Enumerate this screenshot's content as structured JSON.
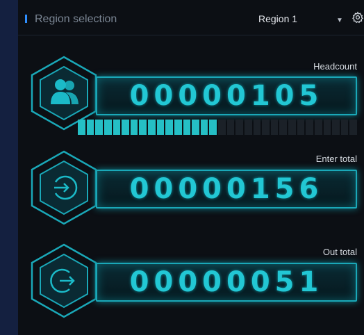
{
  "header": {
    "title": "Region selection",
    "region_value": "Region 1"
  },
  "counters": [
    {
      "label": "Headcount",
      "value": "00000105",
      "icon": "people-icon"
    },
    {
      "label": "Enter total",
      "value": "00000156",
      "icon": "enter-icon"
    },
    {
      "label": "Out total",
      "value": "00000051",
      "icon": "exit-icon"
    }
  ],
  "progress": {
    "filled_segments": 16,
    "total_segments": 32
  },
  "colors": {
    "accent": "#2f8fff",
    "cyan": "#22c7d4",
    "panel_bg": "#0c0f14",
    "page_bg": "#142040"
  }
}
